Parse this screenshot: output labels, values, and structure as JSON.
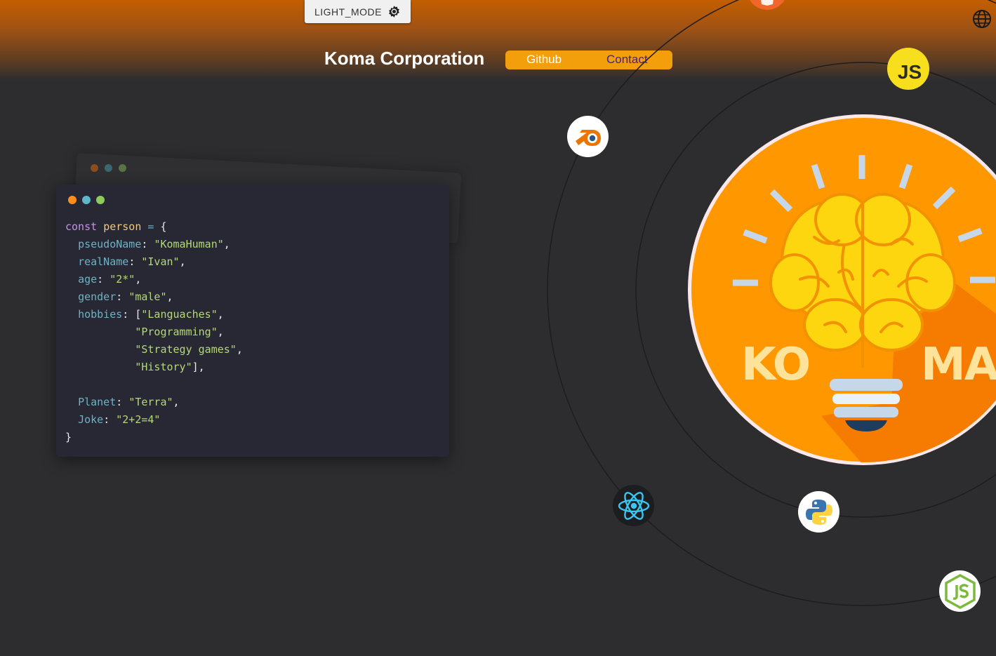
{
  "header": {
    "mode_button_label": "LIGHT_MODE",
    "site_title": "Koma Corporation",
    "nav": {
      "github": "Github",
      "contact": "Contact"
    }
  },
  "code_card": {
    "line1": {
      "kw": "const",
      "name": "person",
      "op": "=",
      "brace": "{"
    },
    "pseudoName": {
      "key": "pseudoName",
      "value": "\"KomaHuman\""
    },
    "realName": {
      "key": "realName",
      "value": "\"Ivan\""
    },
    "age": {
      "key": "age",
      "value": "\"2*\""
    },
    "gender": {
      "key": "gender",
      "value": "\"male\""
    },
    "hobbies": {
      "key": "hobbies",
      "items": [
        "\"Languaches\"",
        "\"Programming\"",
        "\"Strategy games\"",
        "\"History\""
      ]
    },
    "planet": {
      "key": "Planet",
      "value": "\"Terra\""
    },
    "joke": {
      "key": "Joke",
      "value": "\"2+2=4\""
    },
    "close_brace": "}"
  },
  "logo": {
    "left_text": "KO",
    "right_text": "MA"
  },
  "tech_icons": [
    "html5-icon",
    "javascript-icon",
    "blender-icon",
    "react-icon",
    "python-icon",
    "nodejs-icon"
  ],
  "js_badge_text": "JS",
  "colors": {
    "accent": "#f39e0b",
    "header_top": "#c35e00",
    "background": "#2d2d2f",
    "code_bg": "#272833",
    "logo_orange": "#ff9800",
    "dot_orange": "#f98e1d",
    "dot_teal": "#5fb6c8",
    "dot_green": "#8ecb5c"
  }
}
